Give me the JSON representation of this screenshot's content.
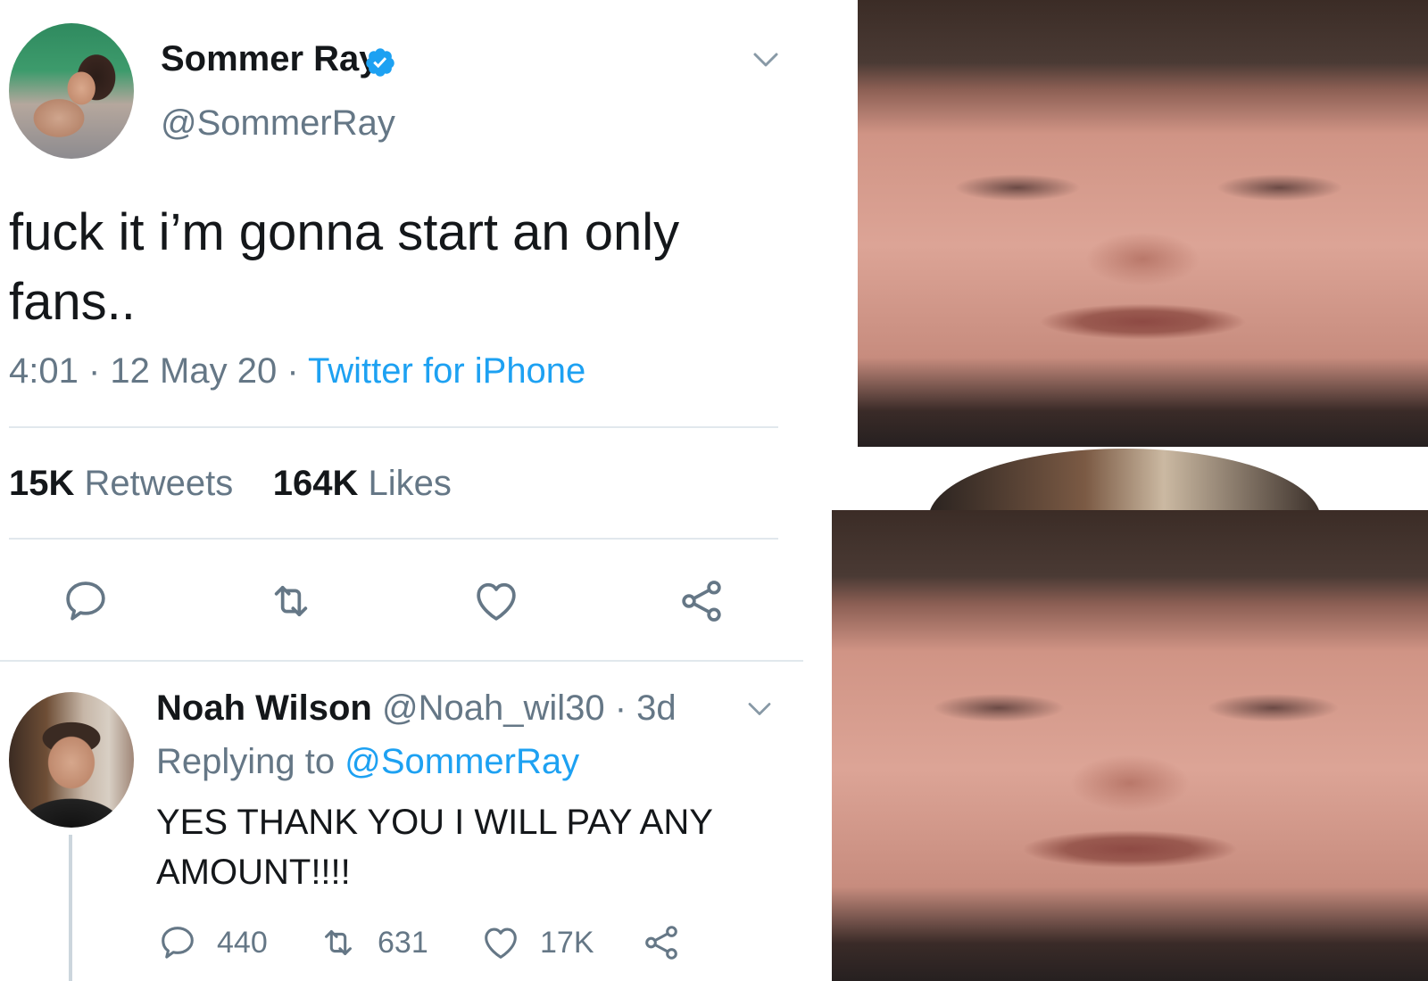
{
  "tweet": {
    "display_name": "Sommer Ray",
    "handle": "@SommerRay",
    "text": "fuck it i’m gonna start an only fans..",
    "time": "4:01",
    "date": "12 May 20",
    "source": "Twitter for iPhone",
    "retweets_count": "15K",
    "retweets_label": "Retweets",
    "likes_count": "164K",
    "likes_label": "Likes"
  },
  "reply": {
    "display_name": "Noah Wilson",
    "handle": "@Noah_wil30",
    "age": "3d",
    "replying_label": "Replying to",
    "replying_to": "@SommerRay",
    "text": "YES THANK YOU I WILL PAY ANY AMOUNT!!!!",
    "reply_count": "440",
    "retweet_count": "631",
    "like_count": "17K"
  },
  "colors": {
    "accent": "#1da1f2",
    "muted": "#657786",
    "text": "#14171a",
    "divider": "#e1e8ed"
  },
  "icons": [
    "verified-badge-icon",
    "chevron-down-icon",
    "reply-icon",
    "retweet-icon",
    "like-icon",
    "share-icon"
  ]
}
